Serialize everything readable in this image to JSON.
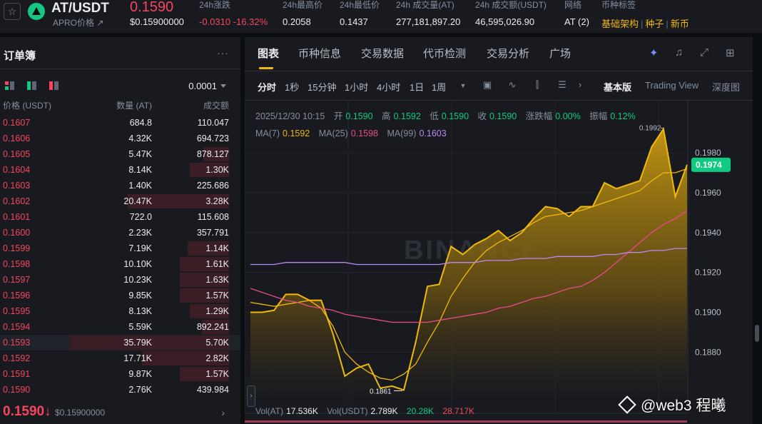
{
  "ticker": {
    "star_icon": "star-outline-icon",
    "pair": "AT/USDT",
    "subtitle": "APRO价格 ↗",
    "last_price": "0.1590",
    "last_price_usd": "$0.15900000",
    "stats": [
      {
        "label": "24h涨跌",
        "value": "-0.0310 -16.32%",
        "red": true
      },
      {
        "label": "24h最高价",
        "value": "0.2058"
      },
      {
        "label": "24h最低价",
        "value": "0.1437"
      },
      {
        "label": "24h 成交量(AT)",
        "value": "277,181,897.20"
      },
      {
        "label": "24h 成交额(USDT)",
        "value": "46,595,026.90"
      },
      {
        "label": "网络",
        "value": "AT (2)"
      }
    ],
    "tags_label": "币种标签",
    "tags": [
      "基础架构",
      "种子",
      "新币"
    ]
  },
  "orderbook": {
    "title": "订单簿",
    "more": "···",
    "tick_size": "0.0001",
    "headers": {
      "price": "价格 (USDT)",
      "qty": "数量 (AT)",
      "total": "成交额"
    },
    "rows": [
      {
        "price": "0.1607",
        "qty": "684.8",
        "total": "110.047",
        "depth": 0.0
      },
      {
        "price": "0.1606",
        "qty": "4.32K",
        "total": "694.723",
        "depth": 0.0
      },
      {
        "price": "0.1605",
        "qty": "5.47K",
        "total": "878.127",
        "depth": 0.16
      },
      {
        "price": "0.1604",
        "qty": "8.14K",
        "total": "1.30K",
        "depth": 0.25
      },
      {
        "price": "0.1603",
        "qty": "1.40K",
        "total": "225.686",
        "depth": 0.0
      },
      {
        "price": "0.1602",
        "qty": "20.47K",
        "total": "3.28K",
        "depth": 0.64
      },
      {
        "price": "0.1601",
        "qty": "722.0",
        "total": "115.608",
        "depth": 0.0
      },
      {
        "price": "0.1600",
        "qty": "2.23K",
        "total": "357.791",
        "depth": 0.0
      },
      {
        "price": "0.1599",
        "qty": "7.19K",
        "total": "1.14K",
        "depth": 0.26
      },
      {
        "price": "0.1598",
        "qty": "10.10K",
        "total": "1.61K",
        "depth": 0.31
      },
      {
        "price": "0.1597",
        "qty": "10.23K",
        "total": "1.63K",
        "depth": 0.31
      },
      {
        "price": "0.1596",
        "qty": "9.85K",
        "total": "1.57K",
        "depth": 0.31
      },
      {
        "price": "0.1595",
        "qty": "8.13K",
        "total": "1.29K",
        "depth": 0.25
      },
      {
        "price": "0.1594",
        "qty": "5.59K",
        "total": "892.241",
        "depth": 0.17
      },
      {
        "price": "0.1593",
        "qty": "35.79K",
        "total": "5.70K",
        "depth": 1.0,
        "highlight": true
      },
      {
        "price": "0.1592",
        "qty": "17.71K",
        "total": "2.82K",
        "depth": 0.55
      },
      {
        "price": "0.1591",
        "qty": "9.87K",
        "total": "1.57K",
        "depth": 0.31
      },
      {
        "price": "0.1590",
        "qty": "2.76K",
        "total": "439.984",
        "depth": 0.0
      }
    ],
    "bottom_price": "0.1590↓",
    "bottom_usd": "$0.15900000",
    "next_icon": "chevron-right-icon"
  },
  "chart_panel": {
    "tabs": [
      "图表",
      "币种信息",
      "交易数据",
      "代币检测",
      "交易分析",
      "广场"
    ],
    "timeframes": [
      "分时",
      "1秒",
      "15分钟",
      "1小时",
      "4小时",
      "1日",
      "1周"
    ],
    "modes": [
      "基本版",
      "Trading View",
      "深度图"
    ],
    "ohlc": {
      "date": "2025/12/30 10:15",
      "open_label": "开",
      "open": "0.1590",
      "high_label": "高",
      "high": "0.1592",
      "low_label": "低",
      "low": "0.1590",
      "close_label": "收",
      "close": "0.1590",
      "chg_label": "涨跌幅",
      "chg": "0.00%",
      "amp_label": "振幅",
      "amp": "0.12%"
    },
    "ma": {
      "ma7_label": "MA(7)",
      "ma7": "0.1592",
      "ma25_label": "MA(25)",
      "ma25": "0.1598",
      "ma99_label": "MA(99)",
      "ma99": "0.1603"
    },
    "volume": {
      "vol_at_label": "Vol(AT)",
      "vol_at": "17.536K",
      "vol_usdt_label": "Vol(USDT)",
      "vol_usdt": "2.789K",
      "v1": "20.28K",
      "v2": "28.717K"
    },
    "watermark_main": "BINANCE",
    "colors": {
      "price_line": "#f0b90b",
      "ma7": "#f0b90b",
      "ma25": "#e94b8a",
      "ma99": "#b98af5",
      "current_price_bg": "#0ecb81"
    }
  },
  "chart_data": {
    "type": "area",
    "ylim": [
      0.1854,
      0.1999
    ],
    "y_ticks": [
      "0.1980",
      "0.1960",
      "0.1940",
      "0.1920",
      "0.1900",
      "0.1880"
    ],
    "current_price_label": "0.1974",
    "current_price": 0.1974,
    "high_label": "0.1992",
    "low_label": "0.1861",
    "series": [
      {
        "values": [
          0.19,
          0.19,
          0.1901,
          0.1909,
          0.1909,
          0.1906,
          0.1906,
          0.1889,
          0.1868,
          0.1872,
          0.1874,
          0.1862,
          0.1863,
          0.1861,
          0.1885,
          0.1913,
          0.1914,
          0.1933,
          0.1929,
          0.1934,
          0.1937,
          0.1941,
          0.1936,
          0.194,
          0.1947,
          0.1953,
          0.1952,
          0.1948,
          0.1953,
          0.1953,
          0.1965,
          0.1962,
          0.1964,
          0.1966,
          0.1983,
          0.1992,
          0.1958,
          0.1974
        ]
      },
      {
        "values": [
          0.1905,
          0.1904,
          0.1903,
          0.1904,
          0.1905,
          0.1906,
          0.1902,
          0.1893,
          0.188,
          0.1874,
          0.187,
          0.1867,
          0.1866,
          0.1869,
          0.1874,
          0.1885,
          0.1895,
          0.1908,
          0.1917,
          0.1925,
          0.1931,
          0.1935,
          0.1938,
          0.1941,
          0.1945,
          0.1948,
          0.1949,
          0.195,
          0.1951,
          0.1953,
          0.1955,
          0.1957,
          0.1959,
          0.1961,
          0.1966,
          0.197,
          0.197,
          0.1972
        ]
      },
      {
        "values": [
          0.1912,
          0.191,
          0.1908,
          0.1906,
          0.1905,
          0.1903,
          0.1902,
          0.1901,
          0.1899,
          0.1898,
          0.1897,
          0.1896,
          0.1895,
          0.1895,
          0.1895,
          0.1895,
          0.1896,
          0.1897,
          0.1898,
          0.1899,
          0.19,
          0.1902,
          0.1903,
          0.1905,
          0.1907,
          0.1908,
          0.191,
          0.1912,
          0.1913,
          0.1916,
          0.192,
          0.1925,
          0.193,
          0.1935,
          0.194,
          0.1944,
          0.1947,
          0.1951
        ]
      },
      {
        "values": [
          0.1924,
          0.1924,
          0.1924,
          0.1925,
          0.1925,
          0.1925,
          0.1925,
          0.1925,
          0.1925,
          0.1924,
          0.1924,
          0.1924,
          0.1924,
          0.1924,
          0.1924,
          0.1924,
          0.1924,
          0.1925,
          0.1925,
          0.1925,
          0.1926,
          0.1926,
          0.1926,
          0.1927,
          0.1927,
          0.1927,
          0.1928,
          0.1928,
          0.1928,
          0.1928,
          0.1929,
          0.1929,
          0.193,
          0.193,
          0.1931,
          0.1931,
          0.1932,
          0.1932
        ]
      }
    ]
  },
  "watermark": {
    "text": "@web3  程曦"
  }
}
